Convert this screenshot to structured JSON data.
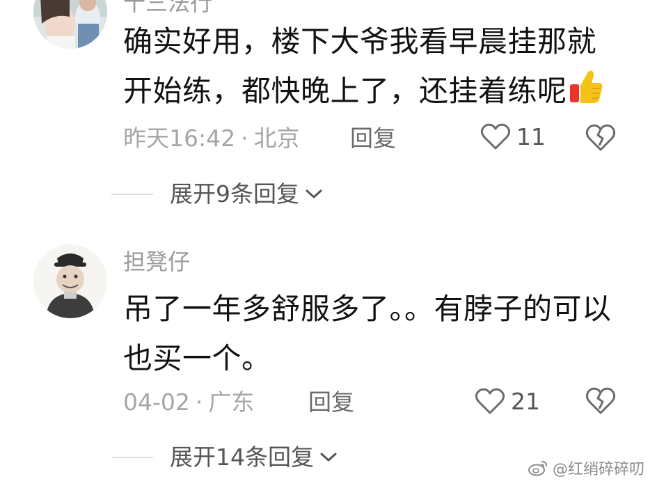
{
  "comments": [
    {
      "username": "十三法行",
      "text": "确实好用，楼下大爷我看早晨挂那就开始练，都快晚上了，还挂着练呢",
      "emoji": "thumbs-up-emoji",
      "time": "昨天16:42",
      "location": "北京",
      "reply_label": "回复",
      "likes": "11",
      "expand_label": "展开9条回复"
    },
    {
      "username": "担凳仔",
      "text": "吊了一年多舒服多了。。有脖子的可以也买一个。",
      "time": "04-02",
      "location": "广东",
      "reply_label": "回复",
      "likes": "21",
      "expand_label": "展开14条回复"
    }
  ],
  "separator": "·",
  "watermark": "@红绡碎碎叨",
  "icons": [
    "heart-outline-icon",
    "broken-heart-icon",
    "chevron-down-icon",
    "weibo-logo-icon"
  ]
}
